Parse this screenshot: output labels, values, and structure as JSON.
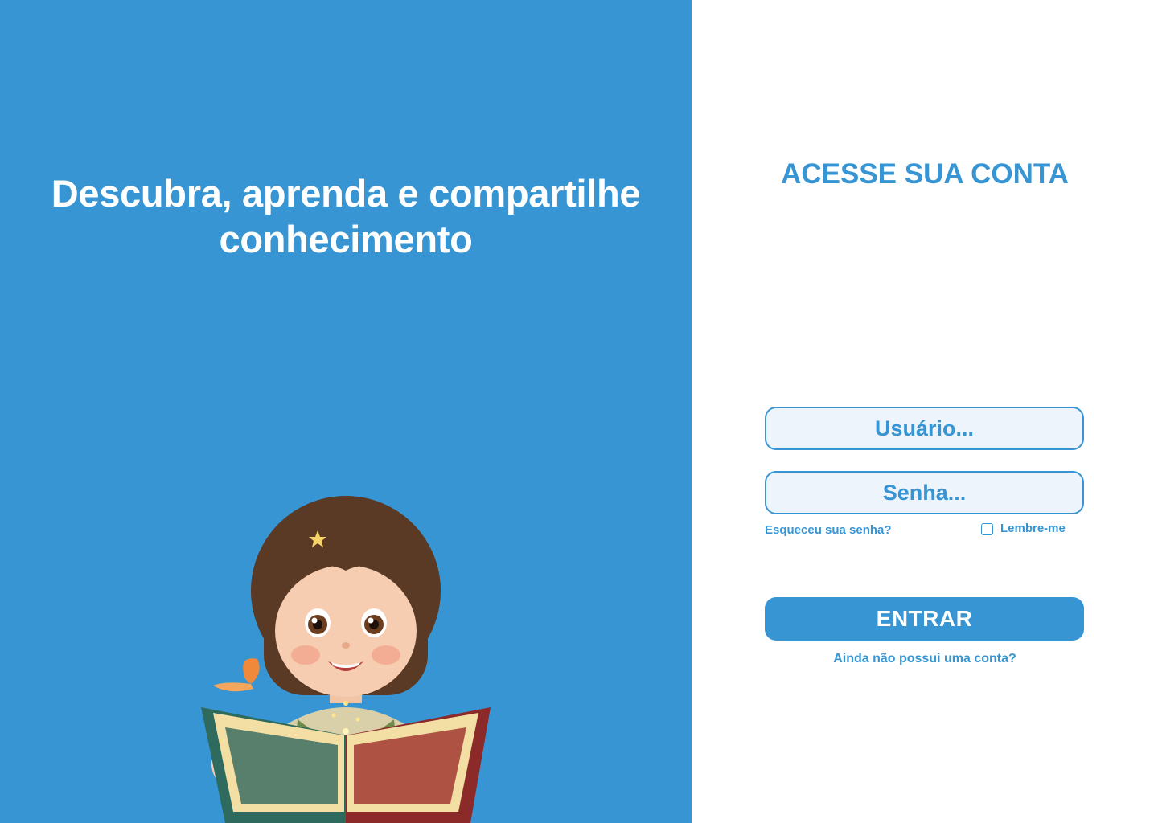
{
  "hero": {
    "title_line1": "Descubra, aprenda e compartilhe",
    "title_line2": "conhecimento"
  },
  "login": {
    "title": "ACESSE SUA CONTA",
    "username_placeholder": "Usuário...",
    "password_placeholder": "Senha...",
    "forgot_password": "Esqueceu sua senha?",
    "remember_me": "Lembre-me",
    "remember_checked": false,
    "submit_label": "ENTRAR",
    "signup_link": "Ainda não possui uma conta?"
  },
  "colors": {
    "brand_blue": "#3795d3",
    "input_background": "#edf4fc",
    "panel_white": "#ffffff"
  }
}
